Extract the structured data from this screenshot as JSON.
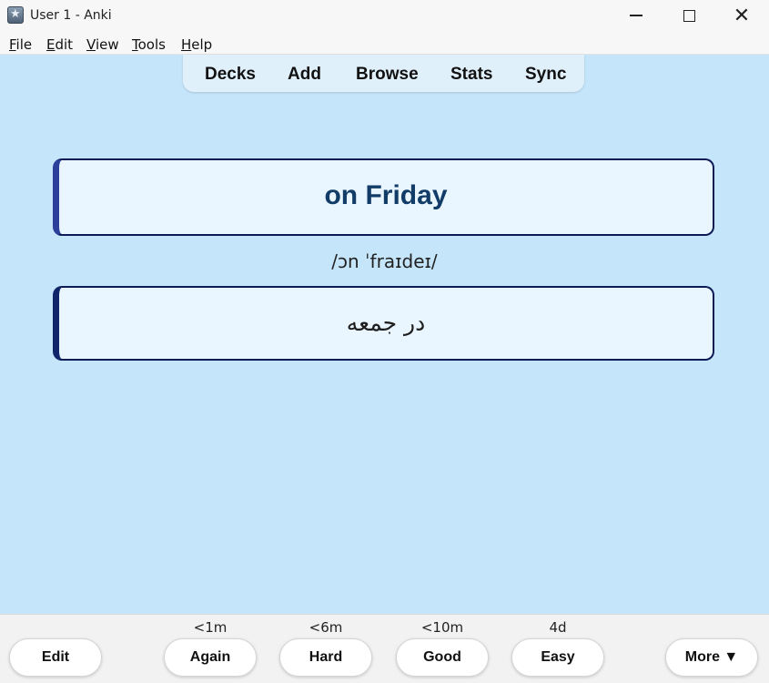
{
  "window": {
    "title": "User 1 - Anki",
    "minimize_glyph": "",
    "close_glyph": "✕"
  },
  "menu": {
    "items": [
      {
        "label": "File",
        "accel": "F",
        "rest": "ile"
      },
      {
        "label": "Edit",
        "accel": "E",
        "rest": "dit"
      },
      {
        "label": "View",
        "accel": "V",
        "rest": "iew"
      },
      {
        "label": "Tools",
        "accel": "T",
        "rest": "ools"
      },
      {
        "label": "Help",
        "accel": "H",
        "rest": "elp"
      }
    ]
  },
  "toolbar": {
    "tabs": [
      "Decks",
      "Add",
      "Browse",
      "Stats",
      "Sync"
    ]
  },
  "card": {
    "front": "on Friday",
    "phonetic": "/ɔn ˈfraɪdeɪ/",
    "back": "در جمعه"
  },
  "bottom": {
    "edit_label": "Edit",
    "more_label": "More ▼",
    "answers": [
      {
        "label": "Again",
        "interval": "<1m"
      },
      {
        "label": "Hard",
        "interval": "<6m"
      },
      {
        "label": "Good",
        "interval": "<10m"
      },
      {
        "label": "Easy",
        "interval": "4d"
      }
    ]
  },
  "colors": {
    "background": "#c5e5fa",
    "card_border": "#0c1a55",
    "front_text": "#123c68"
  }
}
